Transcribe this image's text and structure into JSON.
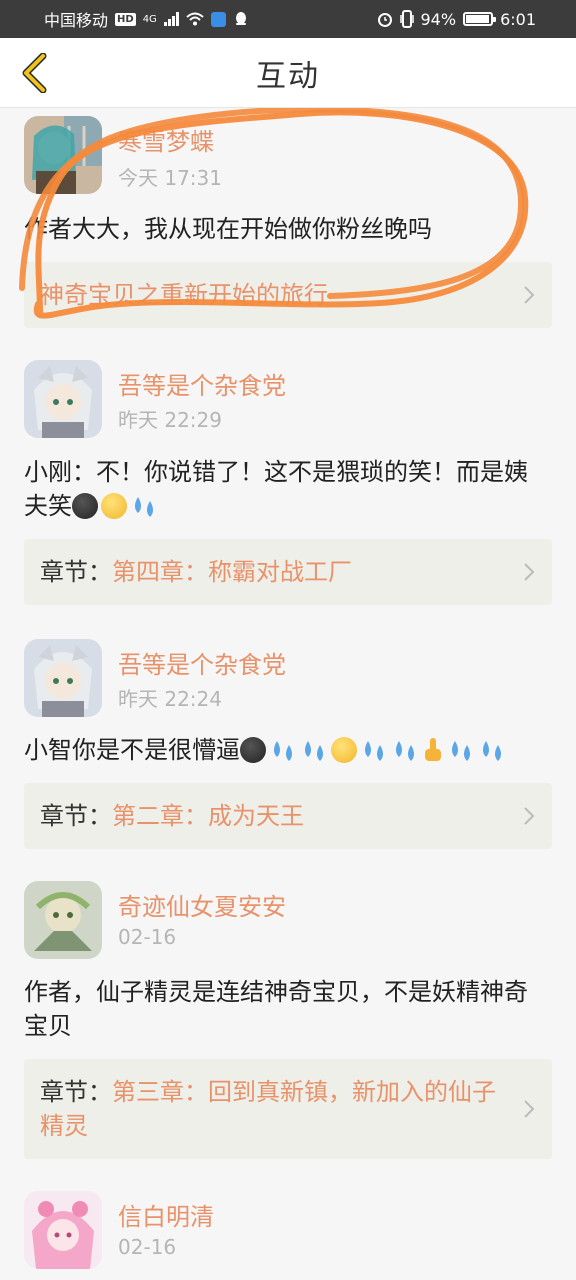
{
  "status_bar": {
    "carrier": "中国移动",
    "hd": "HD",
    "network": "4G",
    "battery": "94%",
    "time": "6:01",
    "battery_level": 0.94
  },
  "nav": {
    "title": "互动"
  },
  "posts": [
    {
      "author": "寒雪梦蝶",
      "time": "今天 17:31",
      "content": "作者大大，我从现在开始做你粉丝晚吗",
      "chapter_prefix": "",
      "chapter_title": "神奇宝贝之重新开始的旅行"
    },
    {
      "author": "吾等是个杂食党",
      "time": "昨天 22:29",
      "content": "小刚：不！你说错了！这不是猥琐的笑！而是姨夫笑",
      "emoji": [
        "dark-face",
        "smirk-face",
        "sweat-drops"
      ],
      "chapter_prefix": "章节：",
      "chapter_title": "第四章：称霸对战工厂"
    },
    {
      "author": "吾等是个杂食党",
      "time": "昨天 22:24",
      "content": "小智你是不是很懵逼",
      "emoji": [
        "dark-face",
        "sweat-drops",
        "sweat-drops",
        "smirk-face",
        "sweat-drops",
        "sweat-drops",
        "middle-finger",
        "sweat-drops",
        "sweat-drops"
      ],
      "chapter_prefix": "章节：",
      "chapter_title": "第二章：成为天王"
    },
    {
      "author": "奇迹仙女夏安安",
      "time": "02-16",
      "content": "作者，仙子精灵是连结神奇宝贝，不是妖精神奇宝贝",
      "chapter_prefix": "章节：",
      "chapter_title": "第三章：回到真新镇，新加入的仙子精灵"
    },
    {
      "author": "信白明清",
      "time": "02-16"
    }
  ],
  "colors": {
    "accent": "#e8926a",
    "back_arrow": "#f0c419",
    "annotation": "#f48a3c"
  }
}
